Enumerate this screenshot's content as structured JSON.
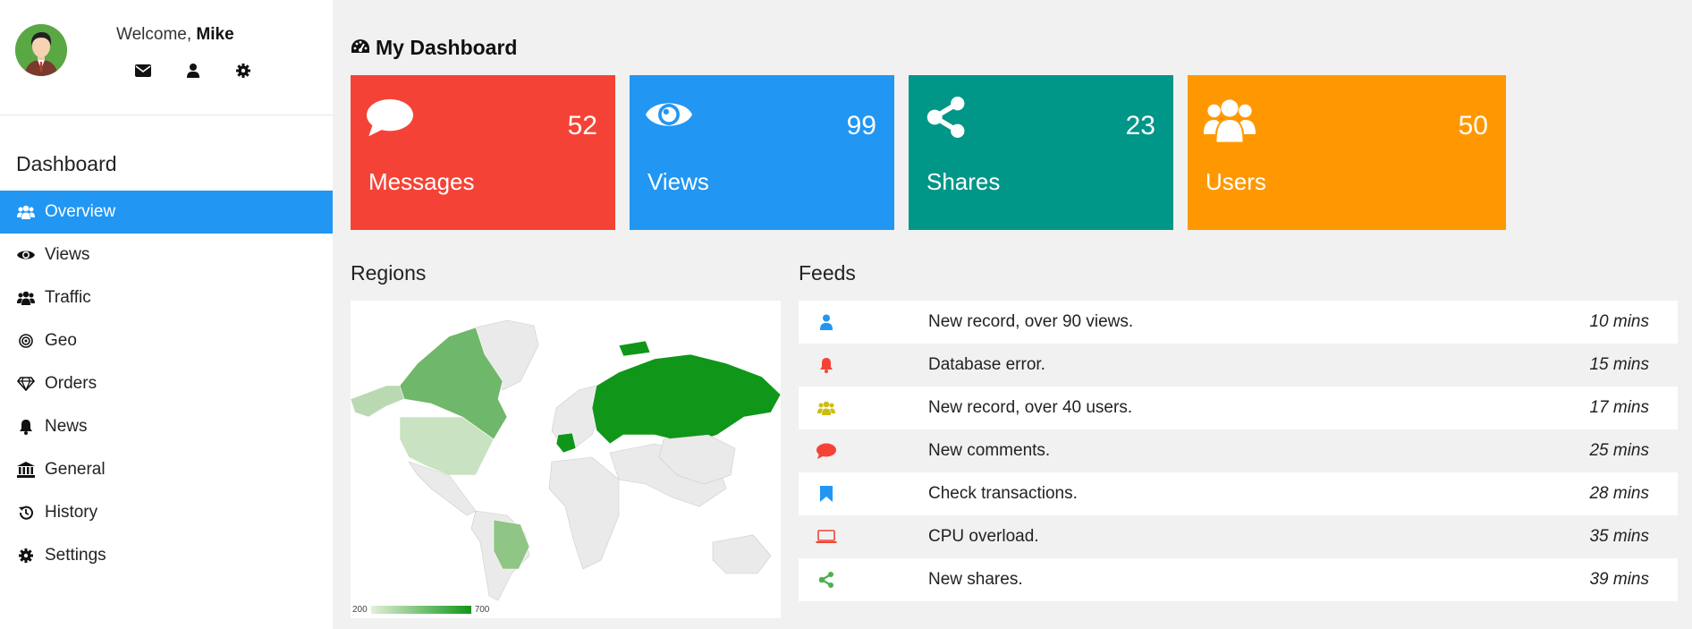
{
  "user": {
    "welcome": "Welcome, ",
    "name": "Mike"
  },
  "sidebar": {
    "title": "Dashboard",
    "items": [
      {
        "label": "Overview",
        "icon": "users-icon",
        "active": true
      },
      {
        "label": "Views",
        "icon": "eye-icon"
      },
      {
        "label": "Traffic",
        "icon": "users-icon"
      },
      {
        "label": "Geo",
        "icon": "bullseye-icon"
      },
      {
        "label": "Orders",
        "icon": "diamond-icon"
      },
      {
        "label": "News",
        "icon": "bell-icon"
      },
      {
        "label": "General",
        "icon": "bank-icon"
      },
      {
        "label": "History",
        "icon": "history-icon"
      },
      {
        "label": "Settings",
        "icon": "cog-icon"
      }
    ]
  },
  "main": {
    "title": "My Dashboard",
    "cards": [
      {
        "label": "Messages",
        "value": "52",
        "color": "#f44336",
        "icon": "comment-icon"
      },
      {
        "label": "Views",
        "value": "99",
        "color": "#2196F3",
        "icon": "eye-icon"
      },
      {
        "label": "Shares",
        "value": "23",
        "color": "#009688",
        "icon": "share-icon"
      },
      {
        "label": "Users",
        "value": "50",
        "color": "#ff9800",
        "icon": "users-icon"
      }
    ],
    "regions_title": "Regions",
    "map_legend": {
      "min": "200",
      "max": "700"
    },
    "feeds_title": "Feeds",
    "feeds": [
      {
        "icon": "user-icon",
        "color": "#2196F3",
        "text": "New record, over 90 views.",
        "time": "10 mins"
      },
      {
        "icon": "bell-icon",
        "color": "#f44336",
        "text": "Database error.",
        "time": "15 mins"
      },
      {
        "icon": "users-icon",
        "color": "#cdbd10",
        "text": "New record, over 40 users.",
        "time": "17 mins"
      },
      {
        "icon": "comment-icon",
        "color": "#f44336",
        "text": "New comments.",
        "time": "25 mins"
      },
      {
        "icon": "bookmark-icon",
        "color": "#2196F3",
        "text": "Check transactions.",
        "time": "28 mins"
      },
      {
        "icon": "laptop-icon",
        "color": "#f44336",
        "text": "CPU overload.",
        "time": "35 mins"
      },
      {
        "icon": "share-icon",
        "color": "#4CAF50",
        "text": "New shares.",
        "time": "39 mins"
      }
    ]
  }
}
